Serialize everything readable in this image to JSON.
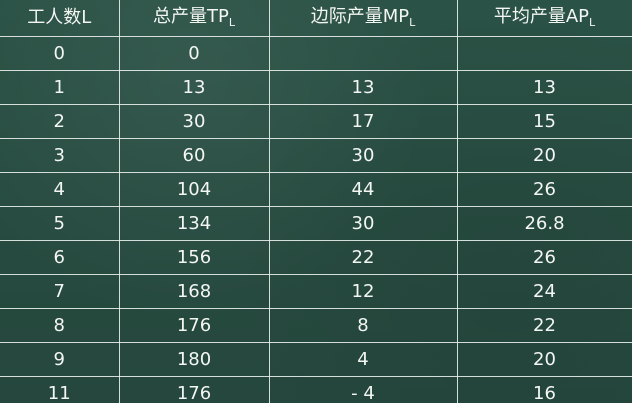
{
  "table": {
    "headers": [
      {
        "main": "工人数L",
        "sub": ""
      },
      {
        "main": "总产量TP",
        "sub": "L"
      },
      {
        "main": "边际产量MP",
        "sub": "L"
      },
      {
        "main": "平均产量AP",
        "sub": "L"
      }
    ],
    "rows": [
      [
        "0",
        "0",
        "",
        ""
      ],
      [
        "1",
        "13",
        "13",
        "13"
      ],
      [
        "2",
        "30",
        "17",
        "15"
      ],
      [
        "3",
        "60",
        "30",
        "20"
      ],
      [
        "4",
        "104",
        "44",
        "26"
      ],
      [
        "5",
        "134",
        "30",
        "26.8"
      ],
      [
        "6",
        "156",
        "22",
        "26"
      ],
      [
        "7",
        "168",
        "12",
        "24"
      ],
      [
        "8",
        "176",
        "8",
        "22"
      ],
      [
        "9",
        "180",
        "4",
        "20"
      ],
      [
        "11",
        "176",
        "- 4",
        "16"
      ]
    ]
  },
  "colors": {
    "background": "#294e43",
    "lines": "#eef2ee",
    "text": "#f3f6f3"
  }
}
